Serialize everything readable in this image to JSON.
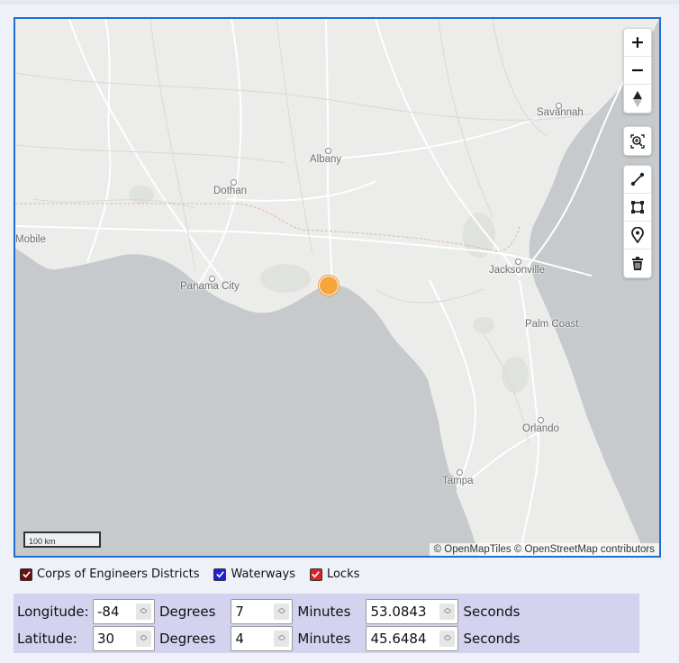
{
  "map": {
    "places": [
      {
        "name": "Savannah"
      },
      {
        "name": "Albany"
      },
      {
        "name": "Dothan"
      },
      {
        "name": "Mobile"
      },
      {
        "name": "Jacksonville"
      },
      {
        "name": "Panama City"
      },
      {
        "name": "Palm Coast"
      },
      {
        "name": "Orlando"
      },
      {
        "name": "Tampa"
      }
    ],
    "scale_label": "100 km",
    "attribution": "© OpenMapTiles  © OpenStreetMap contributors",
    "marker_color": "#f5a53c",
    "controls": {
      "zoom_in": "+",
      "zoom_out": "−",
      "compass_icon": "compass-icon",
      "zoom_box_icon": "zoom-box-icon",
      "draw_line_icon": "draw-line-icon",
      "draw_polygon_icon": "draw-polygon-icon",
      "draw_point_icon": "map-pin-icon",
      "trash_icon": "trash-icon"
    }
  },
  "layers": [
    {
      "label": "Corps of Engineers Districts",
      "checked": true,
      "color": "#6b0e0e"
    },
    {
      "label": "Waterways",
      "checked": true,
      "color": "#1f1fd6"
    },
    {
      "label": "Locks",
      "checked": true,
      "color": "#e01f1f"
    }
  ],
  "coordinates": {
    "longitude": {
      "label": "Longitude:",
      "degrees": "-84",
      "minutes": "7",
      "seconds": "53.0843"
    },
    "latitude": {
      "label": "Latitude:",
      "degrees": "30",
      "minutes": "4",
      "seconds": "45.6484"
    },
    "units": {
      "degrees": "Degrees",
      "minutes": "Minutes",
      "seconds": "Seconds"
    }
  }
}
